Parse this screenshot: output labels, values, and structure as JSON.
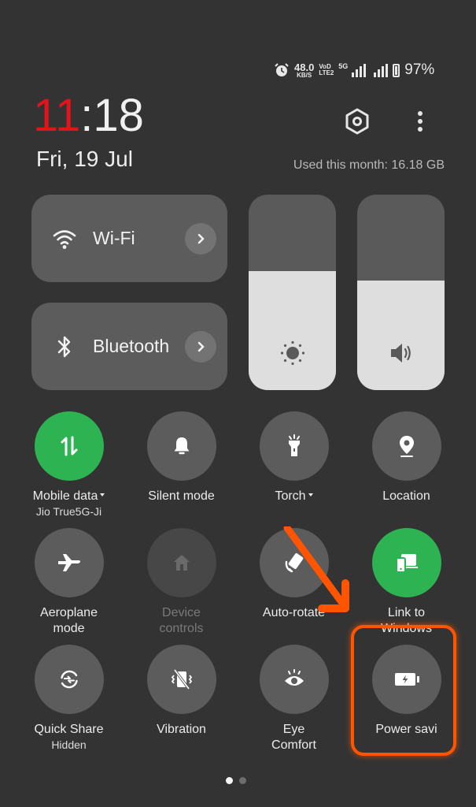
{
  "status_bar": {
    "alarm_icon": "alarm-clock-icon",
    "net_speed_value": "48.0",
    "net_speed_unit": "KB/S",
    "volte_top": "VoD",
    "volte_bottom": "LTE2",
    "network_type": "5G",
    "battery_percent": "97%"
  },
  "header": {
    "clock_hours": "11",
    "clock_separator": ":",
    "clock_minutes": "18",
    "date": "Fri, 19 Jul",
    "data_usage": "Used this month: 16.18 GB",
    "settings_icon": "settings-hex-icon",
    "more_icon": "more-vertical-icon"
  },
  "tiles": [
    {
      "label": "Wi-Fi",
      "icon": "wifi-icon"
    },
    {
      "label": "Bluetooth",
      "icon": "bluetooth-icon"
    }
  ],
  "sliders": {
    "brightness": {
      "level": 0.61,
      "icon": "brightness-icon"
    },
    "volume": {
      "level": 0.56,
      "icon": "volume-icon"
    }
  },
  "toggles": [
    {
      "label": "Mobile data",
      "sublabel": "Jio True5G-Ji",
      "state": "on",
      "dropdown": true,
      "icon": "mobile-data-icon"
    },
    {
      "label": "Silent mode",
      "state": "off",
      "icon": "bell-icon"
    },
    {
      "label": "Torch",
      "state": "off",
      "dropdown": true,
      "icon": "torch-icon"
    },
    {
      "label": "Location",
      "state": "off",
      "icon": "location-pin-icon"
    },
    {
      "label": "Aeroplane",
      "label2": "mode",
      "state": "off",
      "icon": "airplane-icon"
    },
    {
      "label": "Device",
      "label2": "controls",
      "state": "disabled",
      "icon": "home-icon"
    },
    {
      "label": "Auto-rotate",
      "state": "off",
      "icon": "auto-rotate-icon"
    },
    {
      "label": "Link to",
      "label2": "Windows",
      "state": "on",
      "icon": "link-to-windows-icon"
    },
    {
      "label": "Quick Share",
      "sublabel": "Hidden",
      "state": "off",
      "icon": "quick-share-icon"
    },
    {
      "label": "Vibration",
      "state": "off",
      "icon": "vibration-off-icon"
    },
    {
      "label": "Eye",
      "label2": "Comfort",
      "state": "off",
      "icon": "eye-comfort-icon"
    },
    {
      "label": "Power savi",
      "state": "off",
      "icon": "battery-saver-icon"
    }
  ],
  "pagination": {
    "pages": 2,
    "current": 1
  },
  "colors": {
    "background": "#333333",
    "tile": "#5c5c5c",
    "active_green": "#2eb352",
    "clock_hours": "#e3131b",
    "annotation": "#ff5500"
  }
}
